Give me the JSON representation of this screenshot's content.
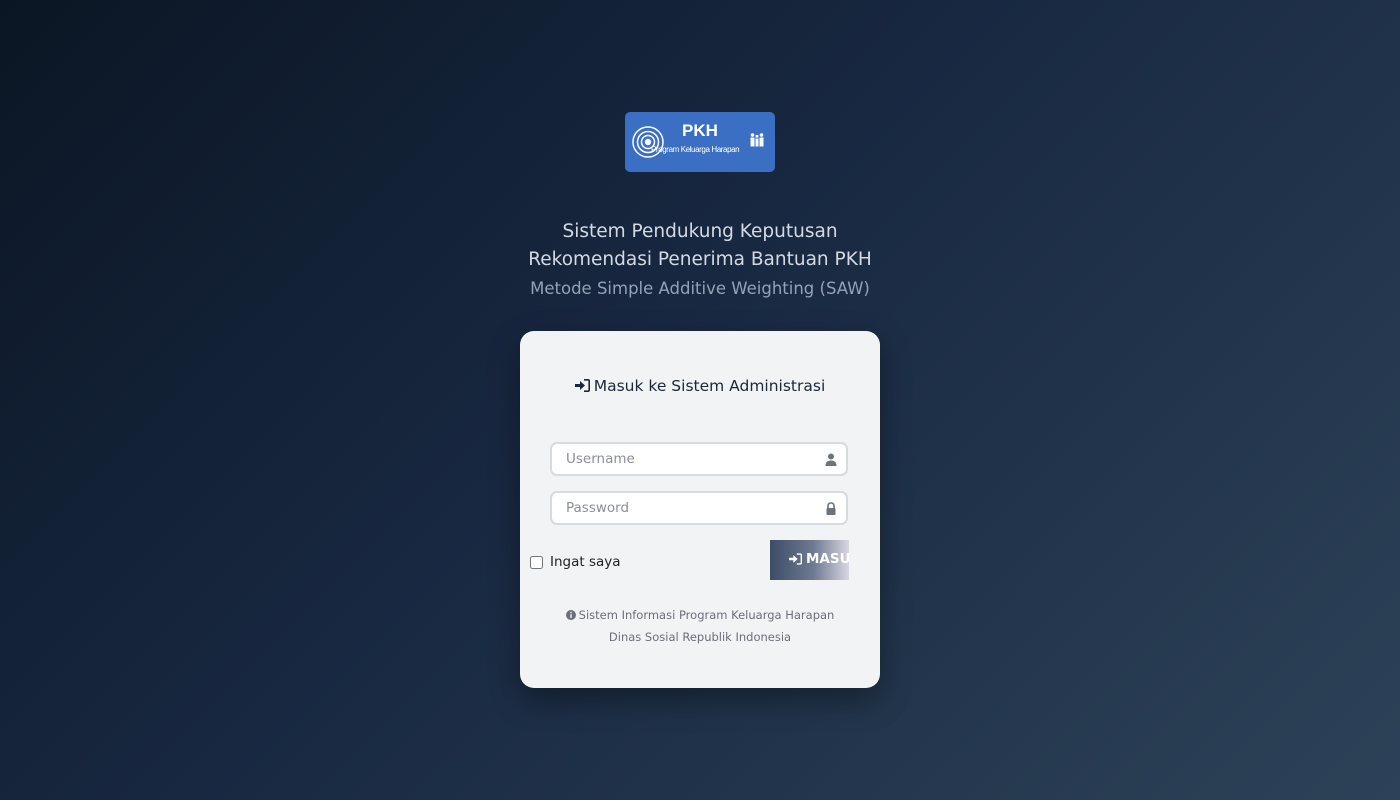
{
  "logo": {
    "brand": "PKH",
    "subtitle": "Program Keluarga Harapan",
    "background_color": "#3a6fc4",
    "left_icon": "concentric-rings-icon",
    "right_icon": "family-icon"
  },
  "header": {
    "line1": "Sistem Pendukung Keputusan",
    "line2": "Rekomendasi Penerima Bantuan PKH",
    "line3": "Metode Simple Additive Weighting (SAW)"
  },
  "login": {
    "title": "Masuk ke Sistem Administrasi",
    "title_icon": "sign-in-icon",
    "username": {
      "placeholder": "Username",
      "value": "",
      "icon": "user-icon"
    },
    "password": {
      "placeholder": "Password",
      "value": "",
      "icon": "lock-icon"
    },
    "remember_label": "Ingat saya",
    "remember_checked": false,
    "submit_label": "MASUK",
    "submit_icon": "sign-in-icon"
  },
  "footer": {
    "icon": "info-circle-icon",
    "line1": "Sistem Informasi Program Keluarga Harapan",
    "line2": "Dinas Sosial Republik Indonesia"
  },
  "colors": {
    "background_start": "#0b1624",
    "background_end": "#2d4258",
    "card": "#f2f3f5",
    "title_text": "#1c2738"
  }
}
